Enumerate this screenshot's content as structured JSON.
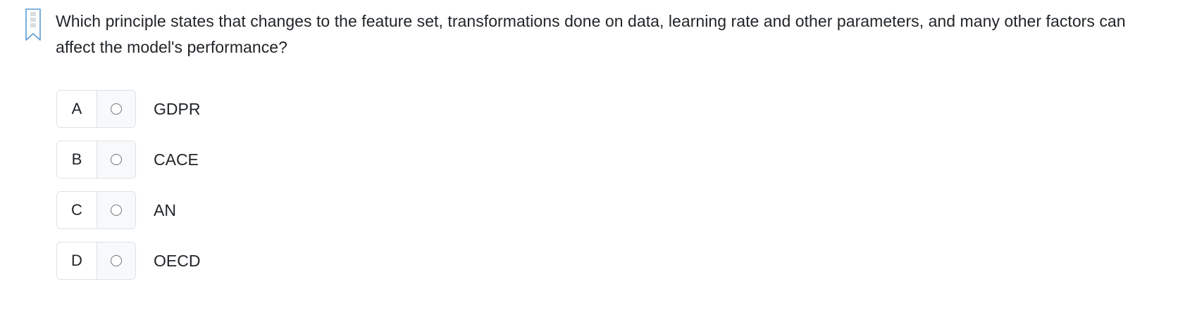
{
  "question": {
    "text": "Which principle states that changes to the feature set, transformations done on data, learning rate and other parameters, and many other factors can affect the model's performance?"
  },
  "options": [
    {
      "letter": "A",
      "text": "GDPR"
    },
    {
      "letter": "B",
      "text": "CACE"
    },
    {
      "letter": "C",
      "text": "AN"
    },
    {
      "letter": "D",
      "text": "OECD"
    }
  ],
  "icons": {
    "bookmark": "bookmark-icon",
    "radio": "radio-unchecked-icon"
  },
  "colors": {
    "text": "#212529",
    "border": "#dee2e6",
    "radio_cell_bg": "#f8f9fa",
    "bookmark_stroke": "#5b9bd5",
    "bookmark_fill": "#d9dde1"
  }
}
